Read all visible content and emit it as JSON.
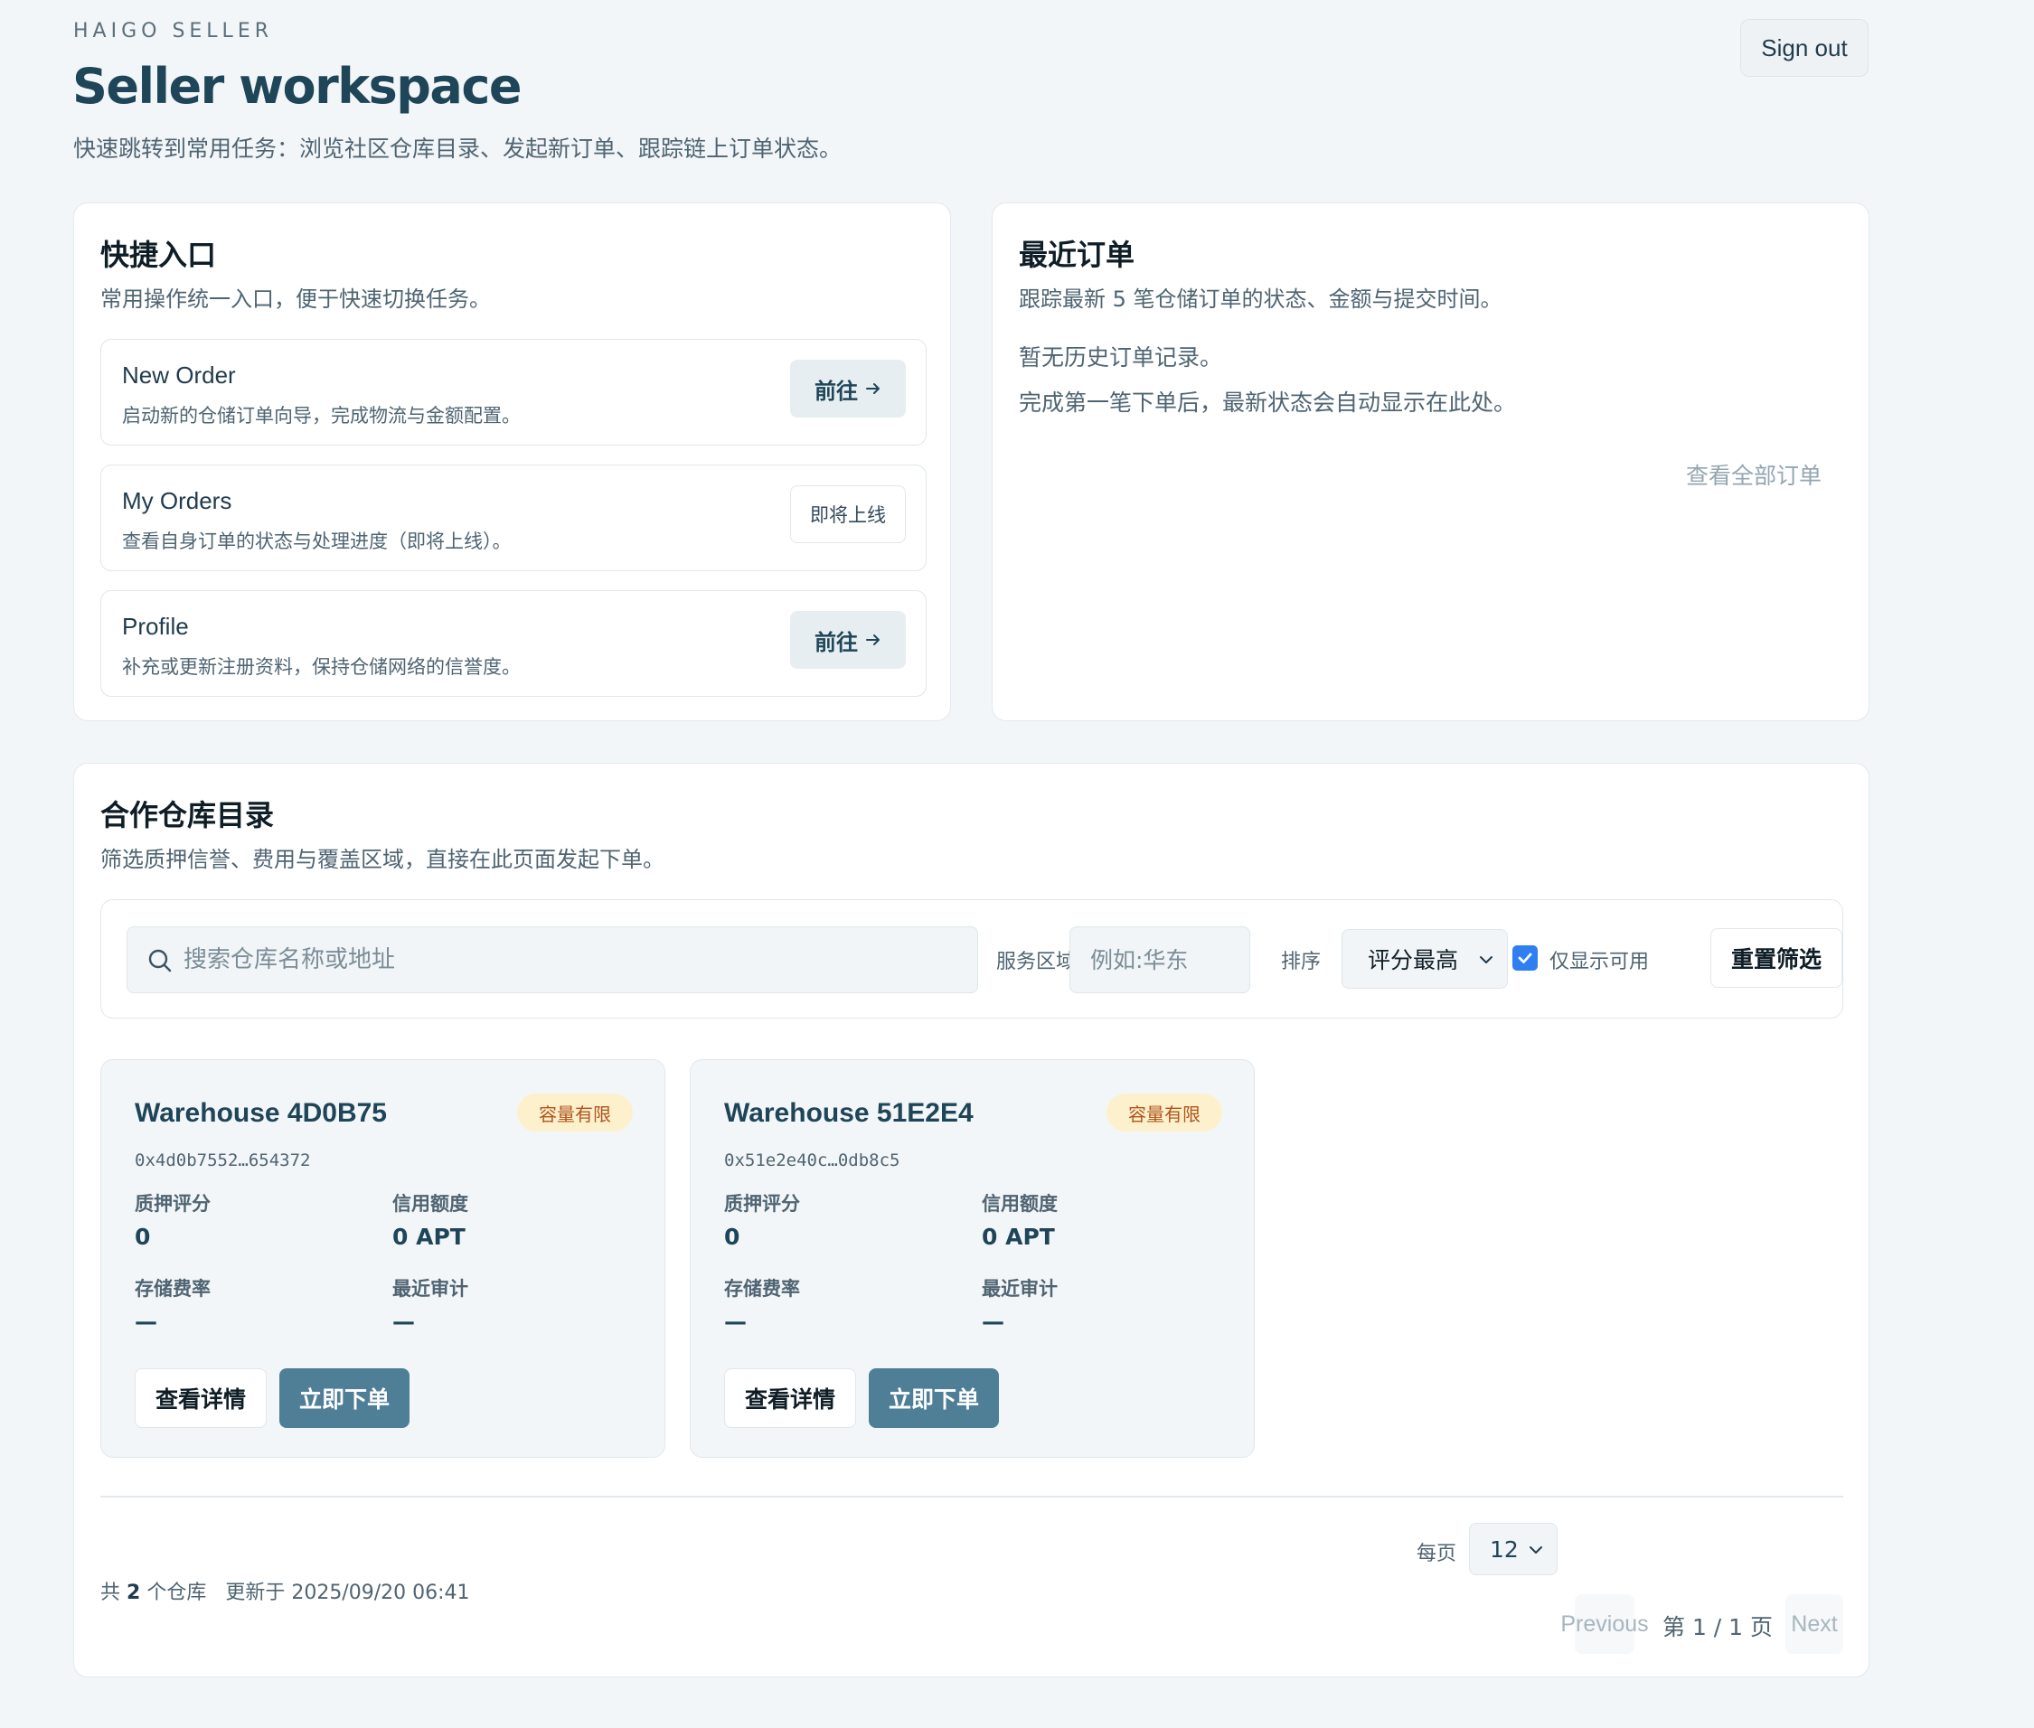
{
  "header": {
    "brand": "HAIGO SELLER",
    "title": "Seller workspace",
    "subtitle": "快速跳转到常用任务：浏览社区仓库目录、发起新订单、跟踪链上订单状态。",
    "signout_label": "Sign out"
  },
  "quick": {
    "title": "快捷入口",
    "desc": "常用操作统一入口，便于快速切换任务。",
    "items": [
      {
        "title": "New Order",
        "desc": "启动新的仓储订单向导，完成物流与金额配置。",
        "button": "前往"
      },
      {
        "title": "My Orders",
        "desc": "查看自身订单的状态与处理进度（即将上线）。",
        "button": "即将上线"
      },
      {
        "title": "Profile",
        "desc": "补充或更新注册资料，保持仓储网络的信誉度。",
        "button": "前往"
      }
    ]
  },
  "recent": {
    "title": "最近订单",
    "desc": "跟踪最新 5 笔仓储订单的状态、金额与提交时间。",
    "empty_line1": "暂无历史订单记录。",
    "empty_line2": "完成第一笔下单后，最新状态会自动显示在此处。",
    "view_all": "查看全部订单"
  },
  "catalog": {
    "title": "合作仓库目录",
    "desc": "筛选质押信誉、费用与覆盖区域，直接在此页面发起下单。",
    "filters": {
      "search_placeholder": "搜索仓库名称或地址",
      "region_label": "服务区域",
      "region_placeholder": "例如:华东",
      "sort_label": "排序",
      "sort_value": "评分最高",
      "available_label": "仅显示可用",
      "available_checked": true,
      "reset_label": "重置筛选"
    },
    "warehouses": [
      {
        "name": "Warehouse 4D0B75",
        "badge": "容量有限",
        "address": "0x4d0b7552…654372",
        "stake_label": "质押评分",
        "stake_value": "0",
        "credit_label": "信用额度",
        "credit_value": "0 APT",
        "fee_label": "存储费率",
        "fee_value": "—",
        "audit_label": "最近审计",
        "audit_value": "—",
        "detail_label": "查看详情",
        "order_label": "立即下单"
      },
      {
        "name": "Warehouse 51E2E4",
        "badge": "容量有限",
        "address": "0x51e2e40c…0db8c5",
        "stake_label": "质押评分",
        "stake_value": "0",
        "credit_label": "信用额度",
        "credit_value": "0 APT",
        "fee_label": "存储费率",
        "fee_value": "—",
        "audit_label": "最近审计",
        "audit_value": "—",
        "detail_label": "查看详情",
        "order_label": "立即下单"
      }
    ],
    "footer": {
      "total_prefix": "共",
      "total_count": "2",
      "total_suffix": "个仓库",
      "updated": "更新于 2025/09/20 06:41",
      "per_page_label": "每页",
      "per_page_value": "12",
      "prev_label": "Previous",
      "page_info": "第 1 / 1 页",
      "next_label": "Next"
    }
  },
  "colors": {
    "accent": "#4e7f97",
    "title": "#1f4558",
    "badge_bg": "#fdf0cc",
    "badge_text": "#b0541a",
    "checkbox": "#2f7ff0"
  }
}
